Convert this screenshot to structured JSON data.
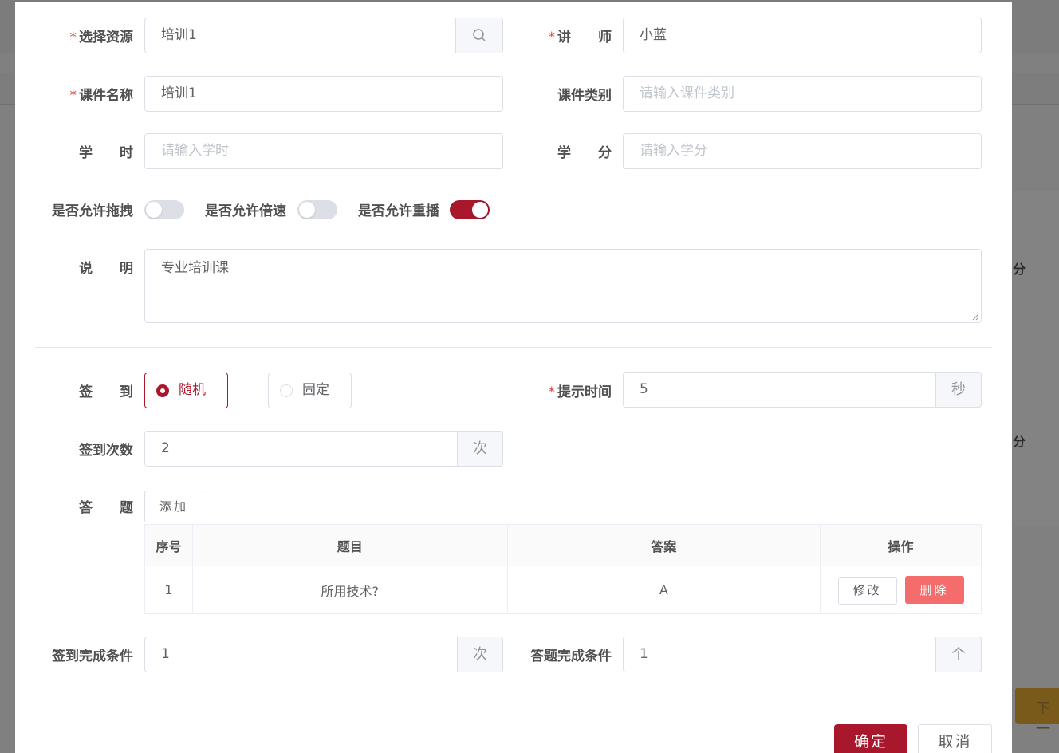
{
  "background": {
    "side_label_1": "分",
    "side_label_2": "分",
    "next_button": "下一"
  },
  "form": {
    "resource": {
      "label": "选择资源",
      "value": "培训1"
    },
    "teacher": {
      "label": "讲　　师",
      "value": "小蓝"
    },
    "course_name": {
      "label": "课件名称",
      "value": "培训1"
    },
    "course_type": {
      "label": "课件类别",
      "placeholder": "请输入课件类别"
    },
    "hours": {
      "label": "学　　时",
      "placeholder": "请输入学时"
    },
    "credits": {
      "label": "学　　分",
      "placeholder": "请输入学分"
    },
    "switches": [
      {
        "label": "是否允许拖拽",
        "on": false
      },
      {
        "label": "是否允许倍速",
        "on": false
      },
      {
        "label": "是否允许重播",
        "on": true
      }
    ],
    "description": {
      "label": "说　　明",
      "value": "专业培训课"
    },
    "sign_in": {
      "label": "签　　到",
      "options": [
        "随机",
        "固定"
      ],
      "selected": "随机"
    },
    "prompt_time": {
      "label": "提示时间",
      "value": "5",
      "unit": "秒"
    },
    "sign_count": {
      "label": "签到次数",
      "value": "2",
      "unit": "次"
    },
    "questions": {
      "label": "答　　题",
      "add_button": "添加",
      "columns": [
        "序号",
        "题目",
        "答案",
        "操作"
      ],
      "rows": [
        {
          "index": "1",
          "question": "所用技术?",
          "answer": "A",
          "edit": "修改",
          "delete": "删除"
        }
      ]
    },
    "sign_complete": {
      "label": "签到完成条件",
      "value": "1",
      "unit": "次"
    },
    "answer_complete": {
      "label": "答题完成条件",
      "value": "1",
      "unit": "个"
    }
  },
  "footer": {
    "confirm": "确定",
    "cancel": "取消"
  },
  "colors": {
    "primary": "#a8172c",
    "danger": "#f56c6c"
  }
}
